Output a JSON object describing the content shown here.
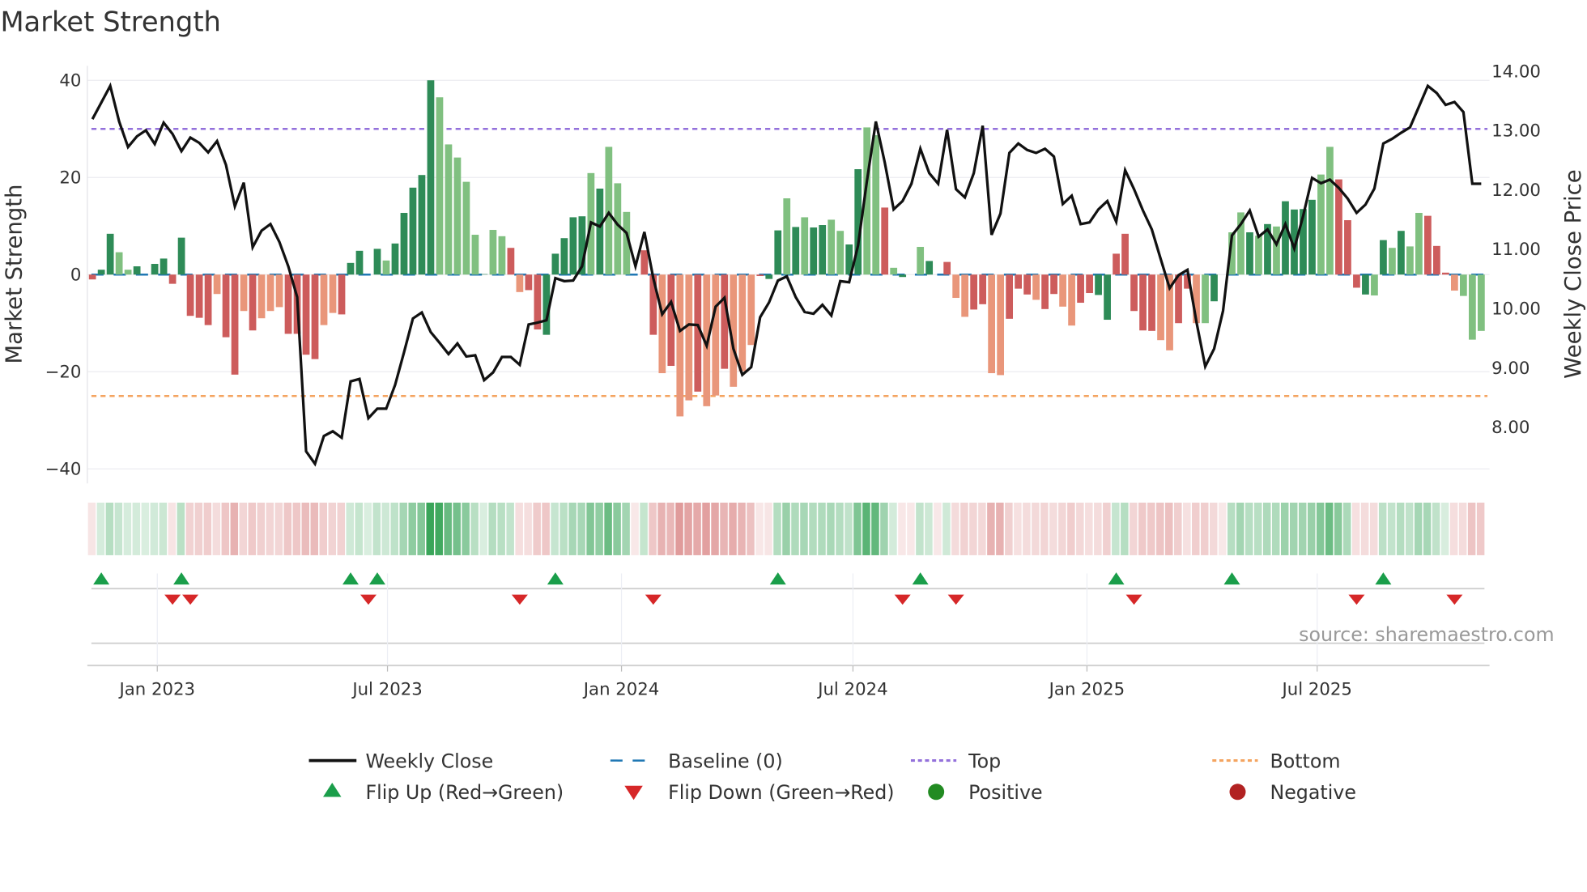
{
  "chart_data": {
    "type": "bar",
    "title": "Market Strength",
    "ylabel": "Market Strength",
    "y2label": "Weekly Close Price",
    "start_date": "2022-11-11",
    "frequency": "weekly",
    "ylim": [
      -43,
      43
    ],
    "y2lim": [
      7.05,
      14.09
    ],
    "yticks": [
      40,
      20,
      0,
      -20,
      -40
    ],
    "ytick_labels": [
      "40",
      "20",
      "0",
      "−20",
      "−40"
    ],
    "y2ticks": [
      14,
      13,
      12,
      11,
      10,
      9,
      8
    ],
    "y2tick_labels": [
      "14.00",
      "13.00",
      "12.00",
      "11.00",
      "10.00",
      "9.00",
      "8.00"
    ],
    "xticks": [
      {
        "label": "Jan 2023",
        "date": "2023-01-01"
      },
      {
        "label": "Jul 2023",
        "date": "2023-07-01"
      },
      {
        "label": "Jan 2024",
        "date": "2024-01-01"
      },
      {
        "label": "Jul 2024",
        "date": "2024-07-01"
      },
      {
        "label": "Jan 2025",
        "date": "2025-01-01"
      },
      {
        "label": "Jul 2025",
        "date": "2025-07-01"
      }
    ],
    "top_level": 30,
    "bottom_level": -25,
    "baseline": 0,
    "strength": [
      -1,
      1,
      8.4,
      4.6,
      1,
      1.7,
      0,
      2.2,
      3.3,
      -1.9,
      7.6,
      -8.5,
      -8.9,
      -10.4,
      -4,
      -12.9,
      -20.6,
      -7.5,
      -11.5,
      -9,
      -7.5,
      -6.7,
      -12.2,
      -12.2,
      -16.5,
      -17.4,
      -10.4,
      -7.9,
      -8.2,
      2.4,
      4.9,
      0,
      5.3,
      2.9,
      6.4,
      12.7,
      17.9,
      20.5,
      40,
      36.5,
      26.8,
      24.1,
      19.1,
      8.2,
      0.1,
      9.2,
      7.9,
      5.5,
      -3.6,
      -3.2,
      -11.3,
      -12.4,
      4.3,
      7.5,
      11.8,
      12,
      20.9,
      17.7,
      26.3,
      18.8,
      12.9,
      0,
      5,
      -12.4,
      -20.3,
      -18.8,
      -29.2,
      -25.9,
      -24.1,
      -27.1,
      -24.9,
      -19.4,
      -23.1,
      -19.9,
      -14.5,
      -0.3,
      -0.9,
      9.1,
      15.7,
      9.8,
      11.8,
      9.7,
      10.2,
      11.3,
      9,
      6.2,
      21.7,
      30.3,
      28.7,
      13.8,
      1.4,
      -0.5,
      0,
      5.7,
      2.8,
      0,
      2.6,
      -4.8,
      -8.7,
      -7.2,
      -6.1,
      -20.3,
      -20.7,
      -9.1,
      -2.9,
      -4.1,
      -5.2,
      -7.1,
      -4,
      -6.6,
      -10.5,
      -5.8,
      -3.8,
      -4.2,
      -9.3,
      4.3,
      8.4,
      -7.5,
      -11.5,
      -11.6,
      -13.5,
      -15.6,
      -10,
      -2.9,
      -10,
      -10,
      -5.5,
      0,
      8.7,
      12.8,
      8.7,
      8,
      10.4,
      9.9,
      15.1,
      13.4,
      13.5,
      15.4,
      20.6,
      26.3,
      19.6,
      11.2,
      -2.7,
      -4.1,
      -4.3,
      7.1,
      5.5,
      9,
      5.8,
      12.7,
      12.1,
      5.9,
      0.4,
      -3.3,
      -4.4,
      -13.4,
      -11.6
    ],
    "shades": "RGGggGZGGRGRRRrRRrRrrrRRRRrrRGGZGgGGGGGgggggGggRrRRGGGGGgGggZGRRrRrrRrrRrrrRGGgGgGGggGGggRZGgZGRRrrRRrrRRRrRRrrRRGGRRRRRrrRRrZGGggGgGgGGGGggRRRGgGgGggRRRr",
    "close": [
      13.19,
      13.47,
      13.75,
      13.15,
      12.72,
      12.9,
      13.0,
      12.77,
      13.13,
      12.94,
      12.65,
      12.88,
      12.79,
      12.63,
      12.82,
      12.42,
      11.72,
      12.12,
      11.03,
      11.31,
      11.42,
      11.12,
      10.71,
      10.19,
      7.59,
      7.38,
      7.85,
      7.93,
      7.82,
      8.77,
      8.81,
      8.15,
      8.31,
      8.31,
      8.71,
      9.26,
      9.83,
      9.93,
      9.6,
      9.42,
      9.23,
      9.41,
      9.19,
      9.21,
      8.79,
      8.92,
      9.18,
      9.18,
      9.05,
      9.73,
      9.76,
      9.8,
      10.51,
      10.46,
      10.47,
      10.71,
      11.45,
      11.38,
      11.61,
      11.41,
      11.27,
      10.71,
      11.29,
      10.51,
      9.9,
      10.11,
      9.62,
      9.73,
      9.72,
      9.37,
      10.03,
      10.18,
      9.32,
      8.88,
      9.01,
      9.85,
      10.1,
      10.47,
      10.54,
      10.19,
      9.94,
      9.91,
      10.06,
      9.88,
      10.46,
      10.44,
      11.06,
      12.15,
      13.15,
      12.46,
      11.67,
      11.81,
      12.1,
      12.69,
      12.28,
      12.1,
      13.01,
      12.01,
      11.87,
      12.28,
      13.08,
      11.24,
      11.6,
      12.62,
      12.78,
      12.67,
      12.62,
      12.69,
      12.56,
      11.76,
      11.9,
      11.42,
      11.45,
      11.67,
      11.81,
      11.46,
      12.33,
      12.01,
      11.65,
      11.33,
      10.83,
      10.34,
      10.56,
      10.65,
      9.78,
      9.02,
      9.32,
      9.96,
      11.23,
      11.42,
      11.65,
      11.21,
      11.33,
      11.08,
      11.42,
      11.01,
      11.56,
      12.2,
      12.11,
      12.17,
      12.03,
      11.85,
      11.61,
      11.75,
      12.02,
      12.78,
      12.86,
      12.96,
      13.05,
      13.4,
      13.75,
      13.63,
      13.43,
      13.48,
      13.31,
      12.1,
      12.1
    ],
    "flip_up": [
      1,
      10,
      29,
      32,
      52,
      77,
      93,
      115,
      128,
      145
    ],
    "flip_down": [
      9,
      11,
      31,
      48,
      63,
      91,
      97,
      117,
      142,
      153
    ],
    "legend": [
      {
        "label": "Weekly Close",
        "kind": "line"
      },
      {
        "label": "Baseline (0)",
        "kind": "baseline"
      },
      {
        "label": "Top",
        "kind": "top"
      },
      {
        "label": "Bottom",
        "kind": "bottom"
      },
      {
        "label": "Flip Up (Red→Green)",
        "kind": "flip-up"
      },
      {
        "label": "Flip Down (Green→Red)",
        "kind": "flip-down"
      },
      {
        "label": "Positive",
        "kind": "positive"
      },
      {
        "label": "Negative",
        "kind": "negative"
      }
    ],
    "legend_placement": "bottom",
    "grid": true,
    "colors": {
      "strong_pos": "#2e8b57",
      "weak_pos": "#80c080",
      "strong_neg": "#cd5c5c",
      "weak_neg": "#e9967a",
      "close": "#111111",
      "baseline": "#1f77b4",
      "top": "#9370db",
      "bottom": "#f4a460",
      "flip_up": "#1a9e4a",
      "flip_down": "#d62728",
      "positive": "#228b22",
      "negative": "#b22222"
    }
  },
  "source": "source: sharemaestro.com"
}
